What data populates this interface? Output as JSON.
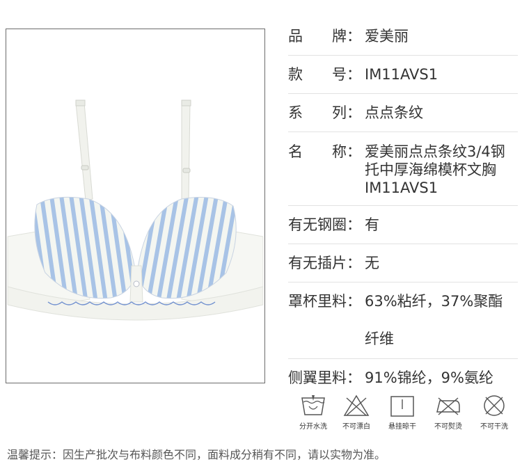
{
  "specs": [
    {
      "label": "品　　牌：",
      "value": "爱美丽"
    },
    {
      "label": "款　　号：",
      "value": "IM11AVS1"
    },
    {
      "label": "系　　列：",
      "value": "点点条纹"
    },
    {
      "label": "名　　称：",
      "value": "爱美丽点点条纹3/4钢托中厚海绵模杯文胸IM11AVS1"
    },
    {
      "label": "有无钢圈：",
      "value": "有"
    },
    {
      "label": "有无插片：",
      "value": "无"
    },
    {
      "label": "罩杯里料：",
      "value": "63%粘纤，37%聚酯纤维"
    },
    {
      "label": "侧翼里料：",
      "value": "91%锦纶，9%氨纶"
    }
  ],
  "care": [
    {
      "label": "分开水洗",
      "icon": "wash-separately-icon"
    },
    {
      "label": "不可漂白",
      "icon": "no-bleach-icon"
    },
    {
      "label": "悬挂晾干",
      "icon": "hang-dry-icon"
    },
    {
      "label": "不可熨烫",
      "icon": "no-iron-icon"
    },
    {
      "label": "不可干洗",
      "icon": "no-dry-clean-icon"
    }
  ],
  "notice": "温馨提示：因生产批次与布料颜色不同，面料成分稍有不同，请以实物为准。",
  "colors": {
    "stripe": "#a8c3e6",
    "fabric": "#f4f6f1",
    "lace": "#6f8fcf",
    "border": "#6b6b6b"
  }
}
